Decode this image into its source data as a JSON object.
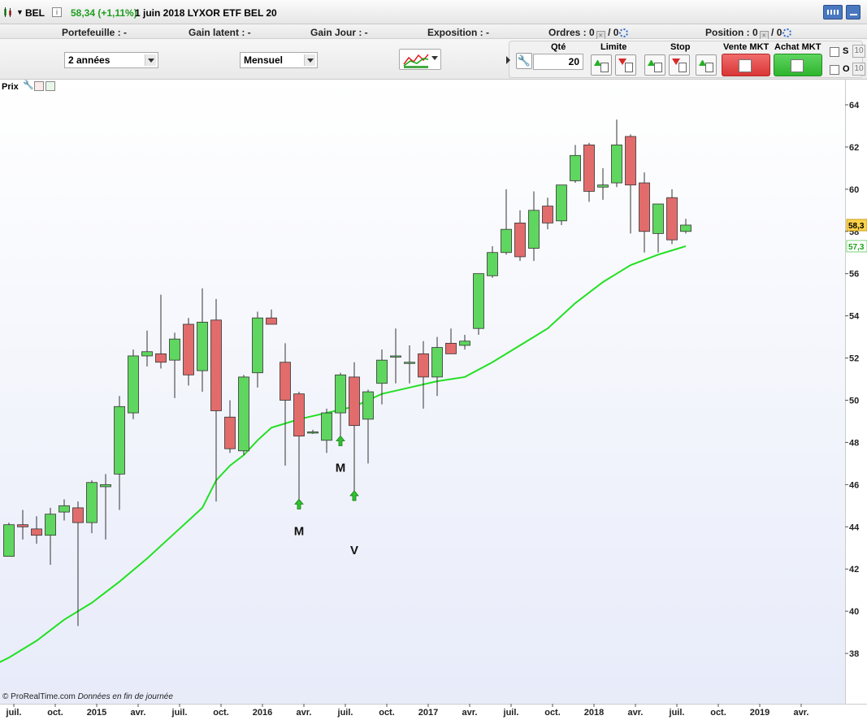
{
  "title_bar": {
    "symbol": "BEL",
    "price_change": "58,34 (+1,11%)",
    "date_and_name": "1 juin 2018 LYXOR ETF BEL 20"
  },
  "info_bar": {
    "portefeuille": "Portefeuille : -",
    "gain_latent": "Gain latent : -",
    "gain_jour": "Gain Jour : -",
    "exposition": "Exposition : -",
    "ordres_label": "Ordres :",
    "ordres_a": "0",
    "ordres_sep": "/",
    "ordres_b": "0",
    "position_label": "Position :",
    "position_a": "0",
    "position_sep": "/",
    "position_b": "0"
  },
  "toolbar": {
    "period_value": "2 années",
    "interval_value": "Mensuel"
  },
  "order_panel": {
    "qty_label": "Qté",
    "qty_value": "20",
    "limit_label": "Limite",
    "stop_label": "Stop",
    "sell_label": "Vente MKT",
    "buy_label": "Achat MKT",
    "s_label": "S",
    "o_label": "O",
    "s_count": "10",
    "o_count": "10"
  },
  "chart_header": {
    "label": "Prix"
  },
  "footer": {
    "copyright": "© ProRealTime.com",
    "note": "Données en fin de journée"
  },
  "colors": {
    "up": "#5fd65f",
    "down": "#e26c6c",
    "ma": "#22e022",
    "price_tag": "#ffd24a"
  },
  "chart_data": {
    "type": "candlestick",
    "ylim": [
      36,
      64.5
    ],
    "y_ticks": [
      "38",
      "40",
      "42",
      "44",
      "46",
      "48",
      "50",
      "52",
      "54",
      "56",
      "58",
      "60",
      "62",
      "64"
    ],
    "price_label": "58,3",
    "ma_label": "57,3",
    "x_tick_labels": [
      "juil.",
      "oct.",
      "2015",
      "avr.",
      "juil.",
      "oct.",
      "2016",
      "avr.",
      "juil.",
      "oct.",
      "2017",
      "avr.",
      "juil.",
      "oct.",
      "2018",
      "avr.",
      "juil.",
      "oct.",
      "2019",
      "avr."
    ],
    "x_tick_months": [
      1,
      4,
      7,
      10,
      13,
      16,
      19,
      22,
      25,
      28,
      31,
      34,
      37,
      40,
      43,
      46,
      49,
      52,
      55,
      58
    ],
    "candles": [
      {
        "m": 0,
        "o": 42.6,
        "h": 44.2,
        "l": 42.6,
        "c": 44.1
      },
      {
        "m": 1,
        "o": 44.1,
        "h": 44.8,
        "l": 43.4,
        "c": 44.0
      },
      {
        "m": 2,
        "o": 43.9,
        "h": 44.5,
        "l": 43.2,
        "c": 43.6
      },
      {
        "m": 3,
        "o": 43.6,
        "h": 44.9,
        "l": 42.2,
        "c": 44.6
      },
      {
        "m": 4,
        "o": 44.7,
        "h": 45.3,
        "l": 44.3,
        "c": 45.0
      },
      {
        "m": 5,
        "o": 44.9,
        "h": 45.2,
        "l": 39.3,
        "c": 44.2
      },
      {
        "m": 6,
        "o": 44.2,
        "h": 46.2,
        "l": 43.7,
        "c": 46.1
      },
      {
        "m": 7,
        "o": 45.9,
        "h": 46.5,
        "l": 43.4,
        "c": 46.0
      },
      {
        "m": 8,
        "o": 46.5,
        "h": 50.2,
        "l": 44.8,
        "c": 49.7
      },
      {
        "m": 9,
        "o": 49.4,
        "h": 52.4,
        "l": 49.1,
        "c": 52.1
      },
      {
        "m": 10,
        "o": 52.1,
        "h": 53.3,
        "l": 51.6,
        "c": 52.3
      },
      {
        "m": 11,
        "o": 52.2,
        "h": 55.0,
        "l": 51.5,
        "c": 51.8
      },
      {
        "m": 12,
        "o": 51.9,
        "h": 53.2,
        "l": 50.1,
        "c": 52.9
      },
      {
        "m": 13,
        "o": 53.6,
        "h": 53.9,
        "l": 50.7,
        "c": 51.2
      },
      {
        "m": 14,
        "o": 51.4,
        "h": 55.3,
        "l": 50.4,
        "c": 53.7
      },
      {
        "m": 15,
        "o": 53.8,
        "h": 54.8,
        "l": 45.2,
        "c": 49.5
      },
      {
        "m": 16,
        "o": 49.2,
        "h": 50.0,
        "l": 47.5,
        "c": 47.7
      },
      {
        "m": 17,
        "o": 47.6,
        "h": 51.2,
        "l": 47.4,
        "c": 51.1
      },
      {
        "m": 18,
        "o": 51.3,
        "h": 54.2,
        "l": 50.6,
        "c": 53.9
      },
      {
        "m": 19,
        "o": 53.9,
        "h": 54.3,
        "l": 53.6,
        "c": 53.6
      },
      {
        "m": 20,
        "o": 51.8,
        "h": 52.7,
        "l": 46.9,
        "c": 50.0
      },
      {
        "m": 21,
        "o": 50.3,
        "h": 50.4,
        "l": 45.0,
        "c": 48.3
      },
      {
        "m": 22,
        "o": 48.5,
        "h": 48.6,
        "l": 48.4,
        "c": 48.5
      },
      {
        "m": 23,
        "o": 48.1,
        "h": 49.6,
        "l": 47.5,
        "c": 49.4
      },
      {
        "m": 24,
        "o": 49.4,
        "h": 51.3,
        "l": 48.2,
        "c": 51.2
      },
      {
        "m": 25,
        "o": 51.1,
        "h": 51.8,
        "l": 45.4,
        "c": 48.8
      },
      {
        "m": 26,
        "o": 49.1,
        "h": 50.5,
        "l": 47.0,
        "c": 50.4
      },
      {
        "m": 27,
        "o": 50.8,
        "h": 52.4,
        "l": 49.8,
        "c": 51.9
      },
      {
        "m": 28,
        "o": 52.1,
        "h": 53.4,
        "l": 50.8,
        "c": 52.1
      },
      {
        "m": 29,
        "o": 51.8,
        "h": 52.6,
        "l": 50.8,
        "c": 51.8
      },
      {
        "m": 30,
        "o": 52.2,
        "h": 52.8,
        "l": 49.6,
        "c": 51.1
      },
      {
        "m": 31,
        "o": 51.1,
        "h": 53.0,
        "l": 50.2,
        "c": 52.5
      },
      {
        "m": 32,
        "o": 52.7,
        "h": 53.4,
        "l": 52.2,
        "c": 52.2
      },
      {
        "m": 33,
        "o": 52.6,
        "h": 53.1,
        "l": 52.4,
        "c": 52.8
      },
      {
        "m": 34,
        "o": 53.4,
        "h": 54.5,
        "l": 53.1,
        "c": 56.0
      },
      {
        "m": 35,
        "o": 55.9,
        "h": 57.3,
        "l": 55.8,
        "c": 57.0
      },
      {
        "m": 36,
        "o": 57.0,
        "h": 60.0,
        "l": 56.9,
        "c": 58.1
      },
      {
        "m": 37,
        "o": 58.4,
        "h": 59.0,
        "l": 56.6,
        "c": 56.8
      },
      {
        "m": 38,
        "o": 57.2,
        "h": 59.9,
        "l": 56.6,
        "c": 59.0
      },
      {
        "m": 39,
        "o": 59.2,
        "h": 59.6,
        "l": 58.1,
        "c": 58.4
      },
      {
        "m": 40,
        "o": 58.5,
        "h": 60.2,
        "l": 58.3,
        "c": 60.2
      },
      {
        "m": 41,
        "o": 60.4,
        "h": 62.1,
        "l": 60.3,
        "c": 61.6
      },
      {
        "m": 42,
        "o": 62.1,
        "h": 62.2,
        "l": 59.4,
        "c": 59.9
      },
      {
        "m": 43,
        "o": 60.1,
        "h": 61.0,
        "l": 59.5,
        "c": 60.2
      },
      {
        "m": 44,
        "o": 60.3,
        "h": 63.3,
        "l": 60.1,
        "c": 62.1
      },
      {
        "m": 45,
        "o": 62.5,
        "h": 62.6,
        "l": 57.9,
        "c": 60.2
      },
      {
        "m": 46,
        "o": 60.3,
        "h": 60.8,
        "l": 57.0,
        "c": 58.0
      },
      {
        "m": 47,
        "o": 57.9,
        "h": 59.3,
        "l": 57.0,
        "c": 59.3
      },
      {
        "m": 48,
        "o": 59.6,
        "h": 60.0,
        "l": 57.4,
        "c": 57.6
      },
      {
        "m": 49,
        "o": 58.0,
        "h": 58.6,
        "l": 57.9,
        "c": 58.3
      }
    ],
    "moving_average": [
      {
        "m": -2.5,
        "v": 37.0
      },
      {
        "m": 0,
        "v": 37.8
      },
      {
        "m": 2,
        "v": 38.6
      },
      {
        "m": 4,
        "v": 39.6
      },
      {
        "m": 6,
        "v": 40.4
      },
      {
        "m": 8,
        "v": 41.4
      },
      {
        "m": 10,
        "v": 42.5
      },
      {
        "m": 12,
        "v": 43.7
      },
      {
        "m": 14,
        "v": 44.9
      },
      {
        "m": 15,
        "v": 46.2
      },
      {
        "m": 16,
        "v": 46.9
      },
      {
        "m": 17,
        "v": 47.4
      },
      {
        "m": 18,
        "v": 48.1
      },
      {
        "m": 19,
        "v": 48.7
      },
      {
        "m": 21,
        "v": 49.1
      },
      {
        "m": 23,
        "v": 49.4
      },
      {
        "m": 25,
        "v": 49.7
      },
      {
        "m": 27,
        "v": 50.3
      },
      {
        "m": 29,
        "v": 50.6
      },
      {
        "m": 31,
        "v": 50.9
      },
      {
        "m": 33,
        "v": 51.1
      },
      {
        "m": 35,
        "v": 51.8
      },
      {
        "m": 37,
        "v": 52.6
      },
      {
        "m": 39,
        "v": 53.4
      },
      {
        "m": 41,
        "v": 54.6
      },
      {
        "m": 43,
        "v": 55.6
      },
      {
        "m": 45,
        "v": 56.4
      },
      {
        "m": 47,
        "v": 56.9
      },
      {
        "m": 48,
        "v": 57.1
      },
      {
        "m": 49,
        "v": 57.3
      }
    ],
    "signals": [
      {
        "m": 21,
        "dir": "up",
        "label": "M",
        "at": 45.0
      },
      {
        "m": 24,
        "dir": "up",
        "label": "M",
        "at": 48.0
      },
      {
        "m": 25,
        "dir": "up",
        "label": "V",
        "at": 45.4
      }
    ]
  }
}
